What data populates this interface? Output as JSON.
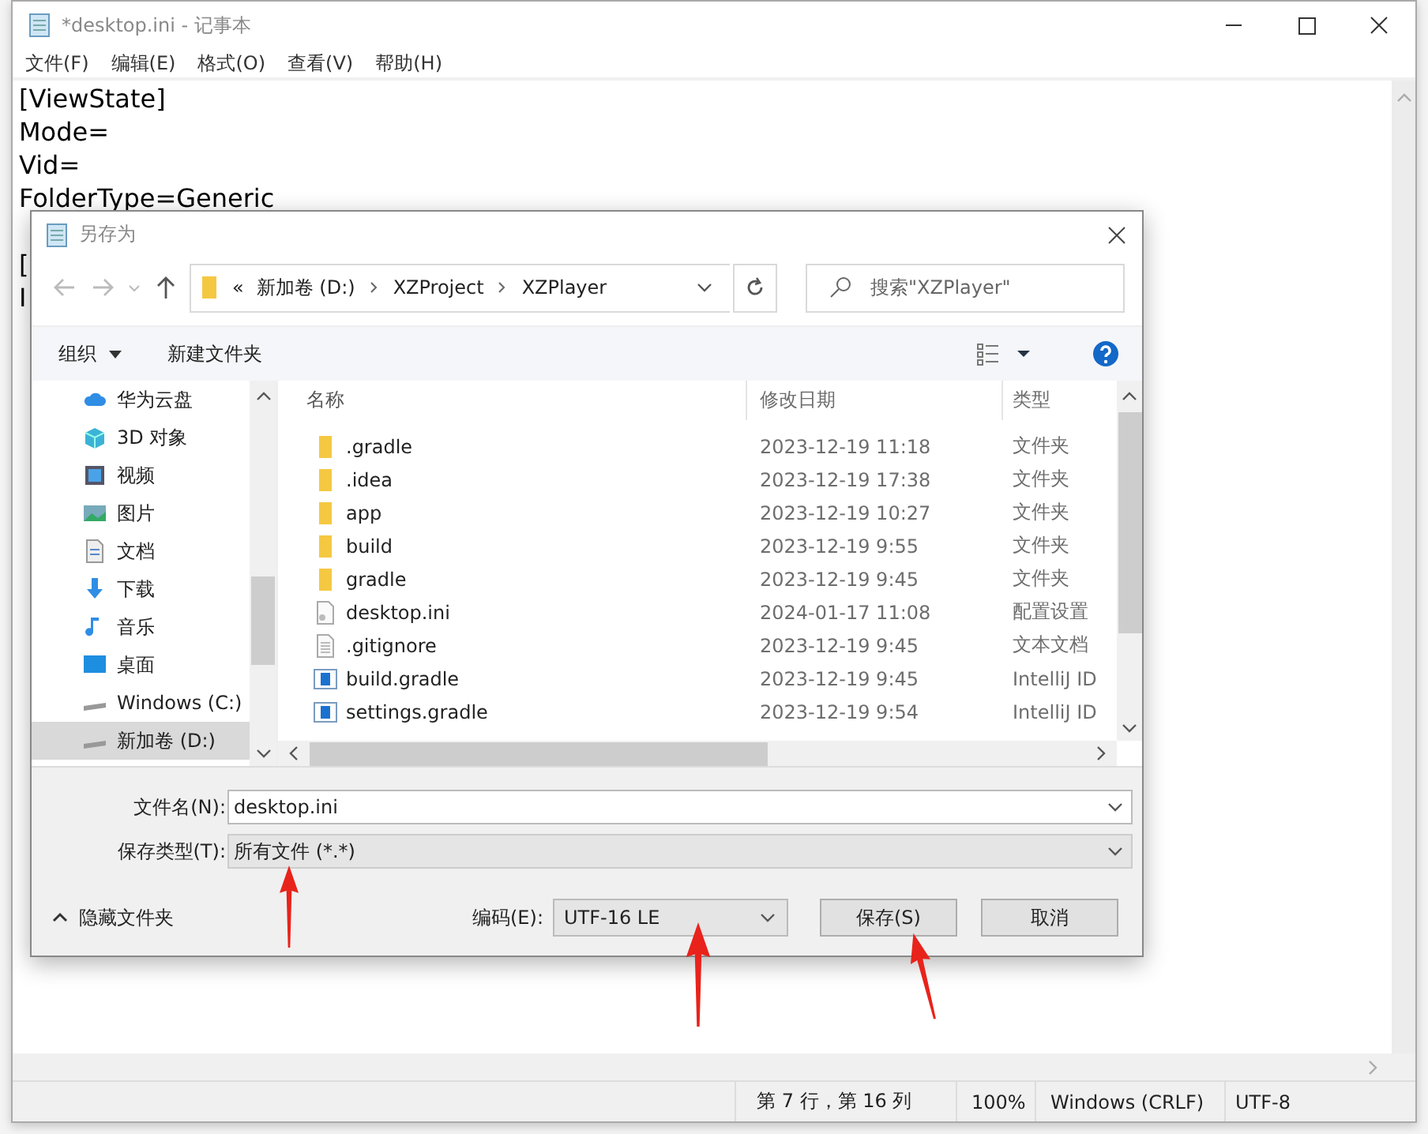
{
  "notepad": {
    "title": "*desktop.ini - 记事本",
    "menu": [
      "文件(F)",
      "编辑(E)",
      "格式(O)",
      "查看(V)",
      "帮助(H)"
    ],
    "sections": [
      [
        "[ViewState]",
        "Mode=",
        "Vid=",
        "FolderType=Generic"
      ],
      [
        "[",
        "I"
      ]
    ],
    "status_bar": [
      "第 7 行，第 16 列",
      "100%",
      "Windows (CRLF)",
      "UTF-8"
    ]
  },
  "dialog": {
    "title": "另存为",
    "breadcrumb": [
      "«",
      "新加卷 (D:)",
      "XZProject",
      "XZPlayer"
    ],
    "search": {
      "placeholder": "搜索\"XZPlayer\""
    },
    "toolbar": {
      "organize": "组织",
      "new_folder": "新建文件夹"
    },
    "sidebar": [
      {
        "label": "华为云盘",
        "kind": "cloud",
        "selected": false
      },
      {
        "label": "3D 对象",
        "kind": "cube",
        "selected": false
      },
      {
        "label": "视频",
        "kind": "video",
        "selected": false
      },
      {
        "label": "图片",
        "kind": "image",
        "selected": false
      },
      {
        "label": "文档",
        "kind": "doc",
        "selected": false
      },
      {
        "label": "下载",
        "kind": "download",
        "selected": false
      },
      {
        "label": "音乐",
        "kind": "music",
        "selected": false
      },
      {
        "label": "桌面",
        "kind": "desktop",
        "selected": false
      },
      {
        "label": "Windows (C:)",
        "kind": "drive",
        "selected": false
      },
      {
        "label": "新加卷 (D:)",
        "kind": "drive",
        "selected": true
      }
    ],
    "columns": [
      "名称",
      "修改日期",
      "类型"
    ],
    "files": [
      {
        "name": ".gradle",
        "kind": "folder",
        "modified": "2023-12-19 11:18",
        "type": "文件夹"
      },
      {
        "name": ".idea",
        "kind": "folder",
        "modified": "2023-12-19 17:38",
        "type": "文件夹"
      },
      {
        "name": "app",
        "kind": "folder",
        "modified": "2023-12-19 10:27",
        "type": "文件夹"
      },
      {
        "name": "build",
        "kind": "folder",
        "modified": "2023-12-19 9:55",
        "type": "文件夹"
      },
      {
        "name": "gradle",
        "kind": "folder",
        "modified": "2023-12-19 9:45",
        "type": "文件夹"
      },
      {
        "name": "desktop.ini",
        "kind": "settings",
        "modified": "2024-01-17 11:08",
        "type": "配置设置"
      },
      {
        "name": ".gitignore",
        "kind": "text",
        "modified": "2023-12-19 9:45",
        "type": "文本文档"
      },
      {
        "name": "build.gradle",
        "kind": "gradle",
        "modified": "2023-12-19 9:45",
        "type": "IntelliJ ID"
      },
      {
        "name": "settings.gradle",
        "kind": "gradle",
        "modified": "2023-12-19 9:54",
        "type": "IntelliJ ID"
      }
    ],
    "file_name": {
      "label": "文件名(N):",
      "value": "desktop.ini"
    },
    "file_type": {
      "label": "保存类型(T):",
      "value": "所有文件  (*.*)"
    },
    "hide_folders": "隐藏文件夹",
    "encoding": {
      "label": "编码(E):",
      "value": "UTF-16 LE"
    },
    "buttons": [
      "保存(S)",
      "取消"
    ]
  }
}
